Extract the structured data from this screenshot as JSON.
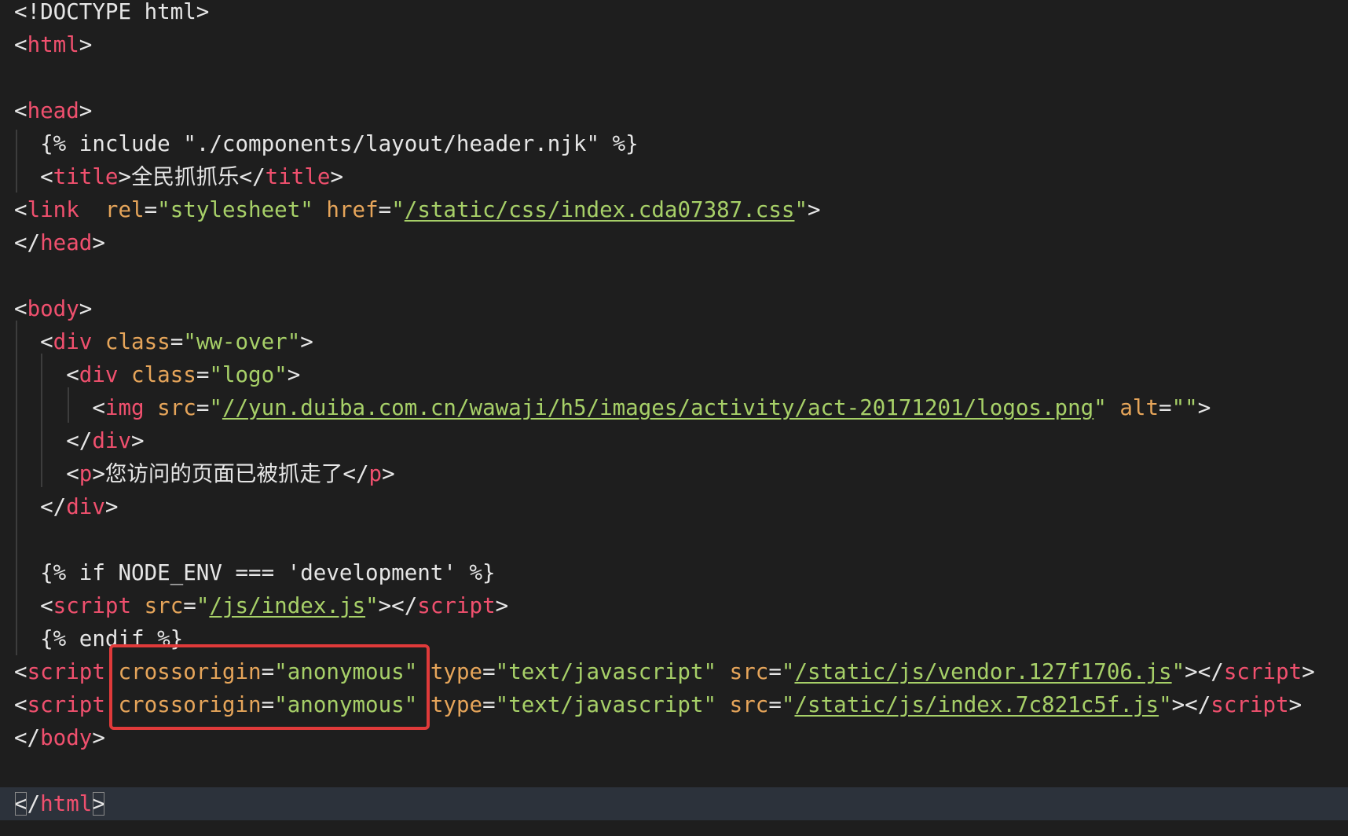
{
  "lines": [
    [
      {
        "c": "p",
        "t": "<!DOCTYPE html>"
      }
    ],
    [
      {
        "c": "p",
        "t": "<"
      },
      {
        "c": "t",
        "t": "html"
      },
      {
        "c": "p",
        "t": ">"
      }
    ],
    [],
    [
      {
        "c": "p",
        "t": "<"
      },
      {
        "c": "t",
        "t": "head"
      },
      {
        "c": "p",
        "t": ">"
      }
    ],
    [
      {
        "c": "b",
        "t": "  {% include \"./components/layout/header.njk\" %}"
      }
    ],
    [
      {
        "c": "p",
        "t": "  <"
      },
      {
        "c": "t",
        "t": "title"
      },
      {
        "c": "p",
        "t": ">"
      },
      {
        "c": "tx cjk",
        "t": "全民抓抓乐"
      },
      {
        "c": "p",
        "t": "</"
      },
      {
        "c": "t",
        "t": "title"
      },
      {
        "c": "p",
        "t": ">"
      }
    ],
    [
      {
        "c": "p",
        "t": "<"
      },
      {
        "c": "t",
        "t": "link"
      },
      {
        "c": "p",
        "t": "  "
      },
      {
        "c": "a",
        "t": "rel"
      },
      {
        "c": "p",
        "t": "="
      },
      {
        "c": "s",
        "t": "\"stylesheet\""
      },
      {
        "c": "p",
        "t": " "
      },
      {
        "c": "a",
        "t": "href"
      },
      {
        "c": "p",
        "t": "="
      },
      {
        "c": "s",
        "t": "\""
      },
      {
        "c": "u",
        "t": "/static/css/index.cda07387.css"
      },
      {
        "c": "s",
        "t": "\""
      },
      {
        "c": "p",
        "t": ">"
      }
    ],
    [
      {
        "c": "p",
        "t": "</"
      },
      {
        "c": "t",
        "t": "head"
      },
      {
        "c": "p",
        "t": ">"
      }
    ],
    [],
    [
      {
        "c": "p",
        "t": "<"
      },
      {
        "c": "t",
        "t": "body"
      },
      {
        "c": "p",
        "t": ">"
      }
    ],
    [
      {
        "c": "p",
        "t": "  <"
      },
      {
        "c": "t",
        "t": "div"
      },
      {
        "c": "p",
        "t": " "
      },
      {
        "c": "a",
        "t": "class"
      },
      {
        "c": "p",
        "t": "="
      },
      {
        "c": "s",
        "t": "\"ww-over\""
      },
      {
        "c": "p",
        "t": ">"
      }
    ],
    [
      {
        "c": "p",
        "t": "    <"
      },
      {
        "c": "t",
        "t": "div"
      },
      {
        "c": "p",
        "t": " "
      },
      {
        "c": "a",
        "t": "class"
      },
      {
        "c": "p",
        "t": "="
      },
      {
        "c": "s",
        "t": "\"logo\""
      },
      {
        "c": "p",
        "t": ">"
      }
    ],
    [
      {
        "c": "p",
        "t": "      <"
      },
      {
        "c": "t",
        "t": "img"
      },
      {
        "c": "p",
        "t": " "
      },
      {
        "c": "a",
        "t": "src"
      },
      {
        "c": "p",
        "t": "="
      },
      {
        "c": "s",
        "t": "\""
      },
      {
        "c": "u",
        "t": "//yun.duiba.com.cn/wawaji/h5/images/activity/act-20171201/logos.png"
      },
      {
        "c": "s",
        "t": "\""
      },
      {
        "c": "p",
        "t": " "
      },
      {
        "c": "a",
        "t": "alt"
      },
      {
        "c": "p",
        "t": "="
      },
      {
        "c": "s",
        "t": "\"\""
      },
      {
        "c": "p",
        "t": ">"
      }
    ],
    [
      {
        "c": "p",
        "t": "    </"
      },
      {
        "c": "t",
        "t": "div"
      },
      {
        "c": "p",
        "t": ">"
      }
    ],
    [
      {
        "c": "p",
        "t": "    <"
      },
      {
        "c": "t",
        "t": "p"
      },
      {
        "c": "p",
        "t": ">"
      },
      {
        "c": "tx cjk",
        "t": "您访问的页面已被抓走了"
      },
      {
        "c": "p",
        "t": "</"
      },
      {
        "c": "t",
        "t": "p"
      },
      {
        "c": "p",
        "t": ">"
      }
    ],
    [
      {
        "c": "p",
        "t": "  </"
      },
      {
        "c": "t",
        "t": "div"
      },
      {
        "c": "p",
        "t": ">"
      }
    ],
    [],
    [
      {
        "c": "b",
        "t": "  {% if NODE_ENV === 'development' %}"
      }
    ],
    [
      {
        "c": "p",
        "t": "  <"
      },
      {
        "c": "t",
        "t": "script"
      },
      {
        "c": "p",
        "t": " "
      },
      {
        "c": "a",
        "t": "src"
      },
      {
        "c": "p",
        "t": "="
      },
      {
        "c": "s",
        "t": "\""
      },
      {
        "c": "u",
        "t": "/js/index.js"
      },
      {
        "c": "s",
        "t": "\""
      },
      {
        "c": "p",
        "t": "></"
      },
      {
        "c": "t",
        "t": "script"
      },
      {
        "c": "p",
        "t": ">"
      }
    ],
    [
      {
        "c": "b",
        "t": "  {% endif %}"
      }
    ],
    [
      {
        "c": "p",
        "t": "<"
      },
      {
        "c": "t",
        "t": "script"
      },
      {
        "c": "p",
        "t": " "
      },
      {
        "c": "a",
        "t": "crossorigin"
      },
      {
        "c": "p",
        "t": "="
      },
      {
        "c": "s",
        "t": "\"anonymous\""
      },
      {
        "c": "p",
        "t": " "
      },
      {
        "c": "a",
        "t": "type"
      },
      {
        "c": "p",
        "t": "="
      },
      {
        "c": "s",
        "t": "\"text/javascript\""
      },
      {
        "c": "p",
        "t": " "
      },
      {
        "c": "a",
        "t": "src"
      },
      {
        "c": "p",
        "t": "="
      },
      {
        "c": "s",
        "t": "\""
      },
      {
        "c": "u",
        "t": "/static/js/vendor.127f1706.js"
      },
      {
        "c": "s",
        "t": "\""
      },
      {
        "c": "p",
        "t": "></"
      },
      {
        "c": "t",
        "t": "script"
      },
      {
        "c": "p",
        "t": ">"
      }
    ],
    [
      {
        "c": "p",
        "t": "<"
      },
      {
        "c": "t",
        "t": "script"
      },
      {
        "c": "p",
        "t": " "
      },
      {
        "c": "a",
        "t": "crossorigin"
      },
      {
        "c": "p",
        "t": "="
      },
      {
        "c": "s",
        "t": "\"anonymous\""
      },
      {
        "c": "p",
        "t": " "
      },
      {
        "c": "a",
        "t": "type"
      },
      {
        "c": "p",
        "t": "="
      },
      {
        "c": "s",
        "t": "\"text/javascript\""
      },
      {
        "c": "p",
        "t": " "
      },
      {
        "c": "a",
        "t": "src"
      },
      {
        "c": "p",
        "t": "="
      },
      {
        "c": "s",
        "t": "\""
      },
      {
        "c": "u",
        "t": "/static/js/index.7c821c5f.js"
      },
      {
        "c": "s",
        "t": "\""
      },
      {
        "c": "p",
        "t": "></"
      },
      {
        "c": "t",
        "t": "script"
      },
      {
        "c": "p",
        "t": ">"
      }
    ],
    [
      {
        "c": "p",
        "t": "</"
      },
      {
        "c": "t",
        "t": "body"
      },
      {
        "c": "p",
        "t": ">"
      }
    ],
    [],
    [
      {
        "c": "p bracket-match",
        "t": "<"
      },
      {
        "c": "p",
        "t": "/"
      },
      {
        "c": "t",
        "t": "html"
      },
      {
        "c": "p bracket-match",
        "t": ">"
      }
    ]
  ],
  "current_line": 24,
  "highlight": {
    "color": "#e03a3a",
    "lines": [
      20,
      21
    ]
  },
  "colors": {
    "background": "#1e1e1e",
    "current_line": "#2c323b",
    "tag": "#f0506e",
    "attribute": "#e6a55a",
    "string": "#a7d068",
    "punctuation": "#e6e6e6"
  }
}
